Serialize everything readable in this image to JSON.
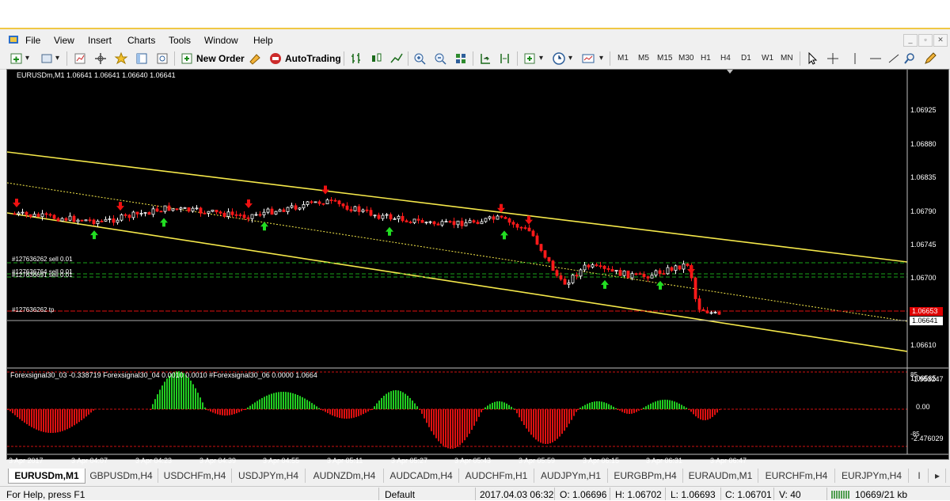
{
  "menu": [
    "File",
    "View",
    "Insert",
    "Charts",
    "Tools",
    "Window",
    "Help"
  ],
  "toolbar": {
    "new_order": "New Order",
    "autotrading": "AutoTrading",
    "timeframes": [
      "M1",
      "M5",
      "M15",
      "M30",
      "H1",
      "H4",
      "D1",
      "W1",
      "MN"
    ]
  },
  "chart": {
    "symbol_info": "EURUSDm,M1  1.06641 1.06641 1.06640 1.06641",
    "price_labels": [
      "1.06925",
      "1.06880",
      "1.06835",
      "1.06790",
      "1.06745",
      "1.06700",
      "1.06610",
      "1.06565"
    ],
    "current_price": "1.06641",
    "tp_price": "1.06653",
    "orders": [
      "#127636262 sell 0.01",
      "#127636764 sell 0.01",
      "#127636691 sell 0.01",
      "#127636262 tp"
    ],
    "indicator_info": "Forexsignal30_03 -0.338719  Forexsignal30_04 0.0010 0.0010  #Forexsignal30_06 0.0000 1.0664",
    "indicator_levels": [
      "1.953247",
      "0.00",
      "-2.476029"
    ],
    "indicator_level_85": "85",
    "indicator_level_neg85": "-85",
    "time_labels": [
      "3 Apr 2017",
      "3 Apr 04:07",
      "3 Apr 04:23",
      "3 Apr 04:39",
      "3 Apr 04:55",
      "3 Apr 05:11",
      "3 Apr 05:27",
      "3 Apr 05:43",
      "3 Apr 05:59",
      "3 Apr 06:15",
      "3 Apr 06:31",
      "3 Apr 06:47"
    ],
    "colors": {
      "bull": "#ffffff",
      "bear": "#ff1a1a",
      "channel": "#f5e84a",
      "grid_green": "#1aa31a",
      "hist_up": "#22cc22",
      "hist_down": "#dd1111"
    }
  },
  "tabs": [
    "EURUSDm,M1",
    "GBPUSDm,H4",
    "USDCHFm,H4",
    "USDJPYm,H4",
    "AUDNZDm,H4",
    "AUDCADm,H4",
    "AUDCHFm,H1",
    "AUDJPYm,H1",
    "EURGBPm,H4",
    "EURAUDm,M1",
    "EURCHFm,H4",
    "EURJPYm,H4"
  ],
  "status": {
    "help": "For Help, press F1",
    "profile": "Default",
    "datetime": "2017.04.03 06:32",
    "open": "O: 1.06696",
    "high": "H: 1.06702",
    "low": "L: 1.06693",
    "close": "C: 1.06701",
    "volume": "V: 40",
    "traffic": "10669/21 kb"
  }
}
